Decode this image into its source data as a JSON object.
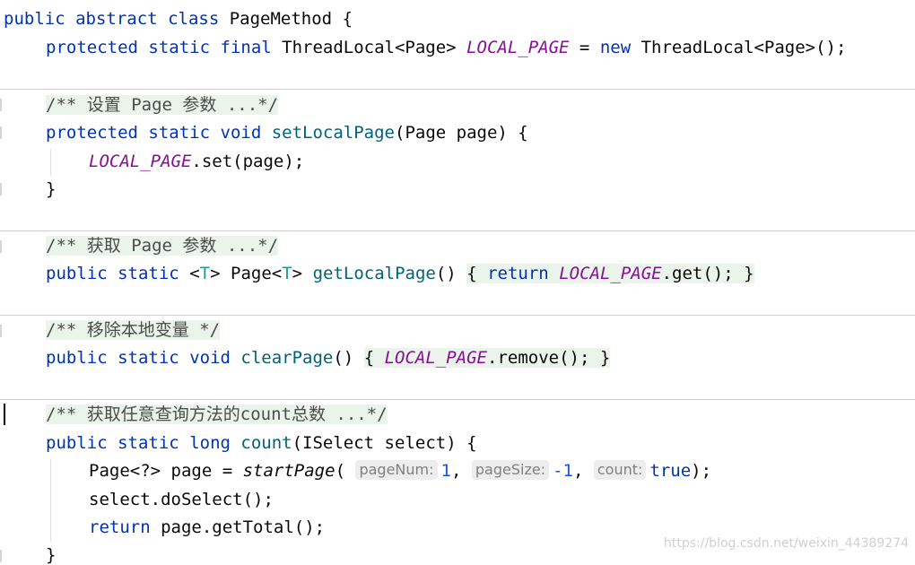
{
  "editor": {
    "class_decl": {
      "kw_public": "public",
      "kw_abstract": "abstract",
      "kw_class": "class",
      "name": "PageMethod",
      "open": "{"
    },
    "field_decl": {
      "kw_protected": "protected",
      "kw_static": "static",
      "kw_final": "final",
      "type": "ThreadLocal<Page>",
      "name": "LOCAL_PAGE",
      "assign": "=",
      "kw_new": "new",
      "init": "ThreadLocal<Page>();"
    },
    "set_method": {
      "comment": "/** 设置 Page 参数 ...*/",
      "kw_protected": "protected",
      "kw_static": "static",
      "kw_void": "void",
      "name": "setLocalPage",
      "params": "(Page page) {",
      "body_field": "LOCAL_PAGE",
      "body_call": ".set(page);",
      "close": "}"
    },
    "get_method": {
      "comment": "/** 获取 Page 参数 ...*/",
      "kw_public": "public",
      "kw_static": "static",
      "generic_open": "<",
      "generic_t": "T",
      "generic_close": ">",
      "ret_type": "Page<",
      "ret_t": "T",
      "ret_close": ">",
      "name": "getLocalPage",
      "parens": "()",
      "open": "{",
      "kw_return": "return",
      "field": "LOCAL_PAGE",
      "call": ".get();",
      "close": "}"
    },
    "clear_method": {
      "comment": "/** 移除本地变量 */",
      "kw_public": "public",
      "kw_static": "static",
      "kw_void": "void",
      "name": "clearPage",
      "parens": "()",
      "open": "{",
      "field": "LOCAL_PAGE",
      "call": ".remove();",
      "close": "}"
    },
    "count_method": {
      "comment": "/** 获取任意查询方法的count总数 ...*/",
      "kw_public": "public",
      "kw_static": "static",
      "kw_long": "long",
      "name": "count",
      "params": "(ISelect select) {",
      "line1_decl": "Page<?> page =",
      "line1_call": "startPage",
      "line1_open": "(",
      "hint_pagenum": "pageNum:",
      "val_pagenum": "1",
      "comma1": ",",
      "hint_pagesize": "pageSize:",
      "val_pagesize": "-1",
      "comma2": ",",
      "hint_count": "count:",
      "val_count": "true",
      "line1_close": ");",
      "line2": "select.doSelect();",
      "kw_return": "return",
      "line3_rest": "page.getTotal();",
      "close": "}"
    }
  },
  "watermark": "https://blog.csdn.net/weixin_44389274"
}
